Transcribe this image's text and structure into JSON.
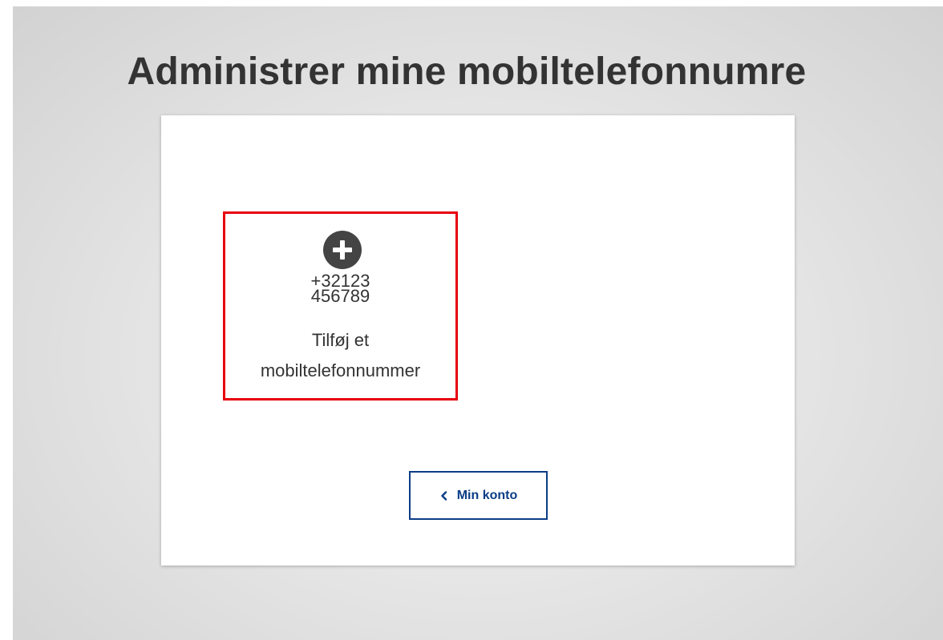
{
  "page": {
    "title": "Administrer mine mobiltelefonnumre"
  },
  "add_tile": {
    "icon": "plus-circle-icon",
    "phone_number_line_1": "+32123",
    "phone_number_line_2": "456789",
    "label_line_1": "Tilføj et",
    "label_line_2": "mobiltelefonnummer"
  },
  "back_button": {
    "icon": "chevron-left-icon",
    "label": "Min konto"
  },
  "colors": {
    "highlight_border": "#e8000d",
    "button_border": "#0b3d86",
    "text": "#333333",
    "icon_fill": "#444444"
  }
}
